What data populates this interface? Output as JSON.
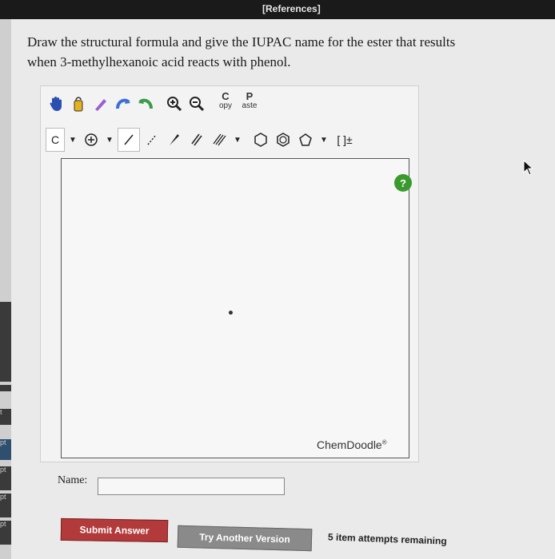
{
  "header": {
    "references_label": "[References]"
  },
  "left_sidebar": {
    "labels": [
      "t",
      "pt",
      "pt",
      "pt",
      "pt",
      "pt"
    ]
  },
  "question": {
    "line1": "Draw the structural formula and give the IUPAC name for the ester that results",
    "line2": "when 3-methylhexanoic acid reacts with phenol."
  },
  "toolbar": {
    "row1_icons": [
      "hand-icon",
      "lasso-icon",
      "eraser-icon",
      "undo-icon",
      "redo-icon",
      "zoom-in-icon",
      "zoom-out-icon"
    ],
    "copy": {
      "big": "C",
      "small": "opy"
    },
    "paste": {
      "big": "P",
      "small": "aste"
    },
    "element_label": "C",
    "row2_icons": [
      "charge-icon",
      "single-bond-icon",
      "dashed-bond-icon",
      "wedge-bond-icon",
      "double-bond-icon",
      "triple-bond-icon",
      "cyclohexane-icon",
      "benzene-icon",
      "pentagon-icon",
      "bracket-icon"
    ],
    "bracket_label": "[ ]±"
  },
  "canvas": {
    "brand": "ChemDoodle",
    "brand_mark": "®",
    "help_label": "?"
  },
  "answer": {
    "name_label": "Name:",
    "name_value": ""
  },
  "actions": {
    "submit_label": "Submit Answer",
    "try_label": "Try Another Version",
    "attempts_text": "5 item attempts remaining"
  },
  "colors": {
    "submit_bg": "#b23a3a",
    "try_bg": "#8a8a8a",
    "help_bg": "#3a9a2e"
  }
}
